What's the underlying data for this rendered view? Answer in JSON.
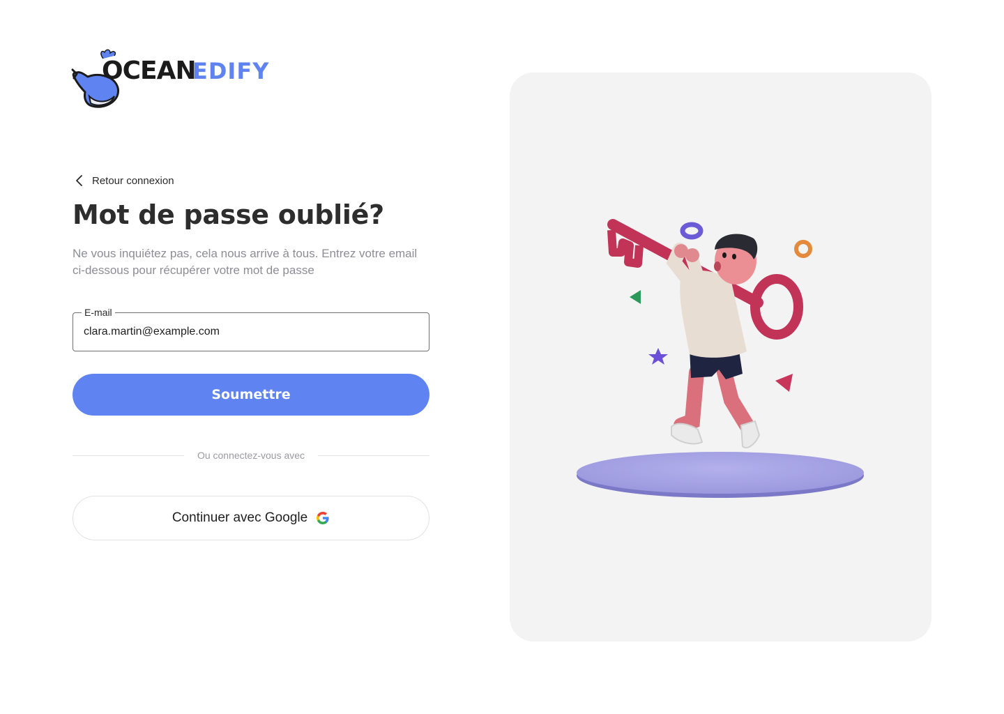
{
  "brand": {
    "logo_text_primary": "OCEAN",
    "logo_text_secondary": "EDIFY",
    "primary_color": "#5f84f2",
    "dark_color": "#1b1b1b"
  },
  "back_link": {
    "label": "Retour connexion",
    "icon": "chevron-left-icon"
  },
  "title": "Mot de passe oublié?",
  "subtitle": "Ne vous inquiétez pas, cela nous arrive à tous. Entrez votre email ci-dessous pour récupérer votre mot de passe",
  "email_field": {
    "label": "E-mail",
    "value": "clara.martin@example.com"
  },
  "submit_button": {
    "label": "Soumettre",
    "color": "#5f84f2"
  },
  "divider_text": "Ou connectez-vous avec",
  "google_button": {
    "label": "Continuer avec Google",
    "icon": "google-icon"
  },
  "illustration": {
    "description_icon": "person-carrying-key-icon",
    "panel_color": "#f3f3f3",
    "key_color": "#d63a63",
    "platform_color": "#a9a6e6"
  }
}
